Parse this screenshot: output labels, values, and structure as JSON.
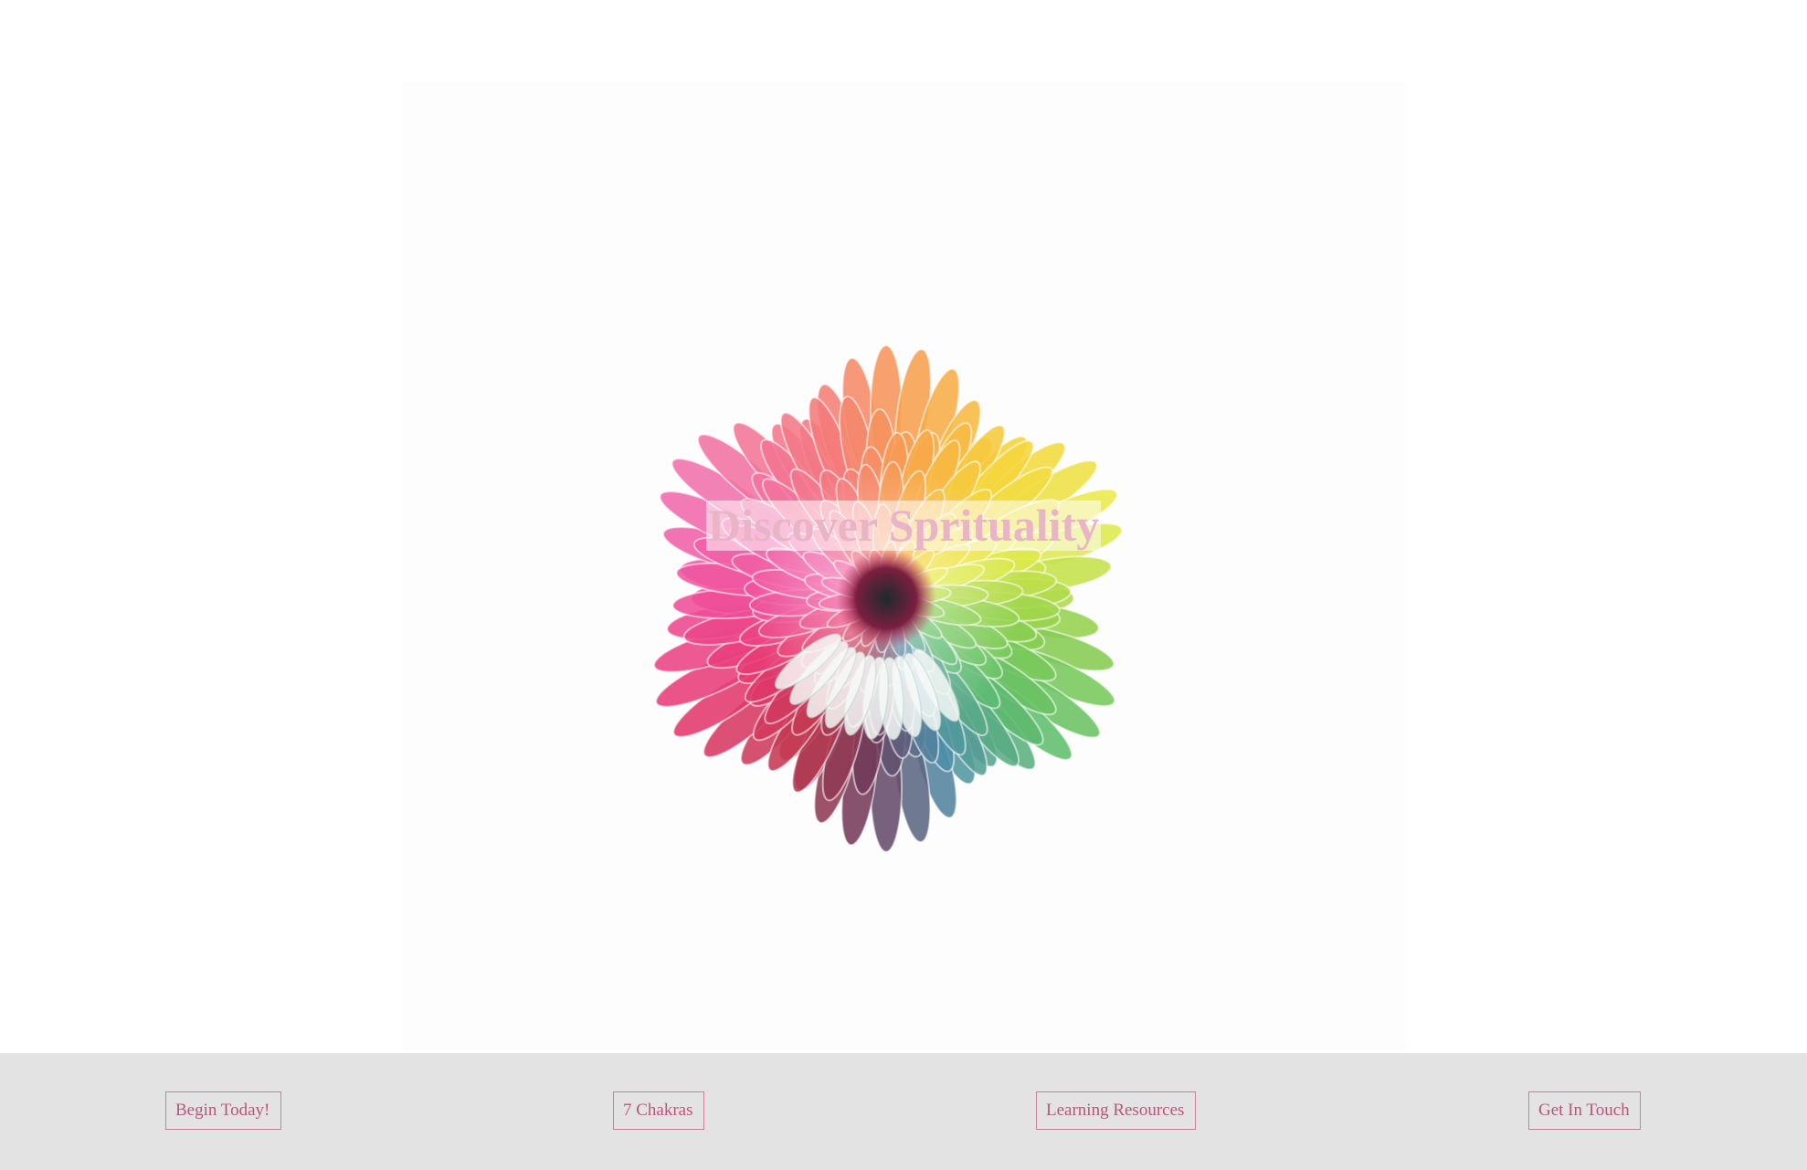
{
  "hero": {
    "title": "Discover Sprituality",
    "image": "rainbow-chrysanthemum-flower",
    "title_color": "#e8b4c6"
  },
  "nav": {
    "background": "#e3e3e3",
    "accent": "#b3587c",
    "items": [
      {
        "label": "Begin Today!"
      },
      {
        "label": "7 Chakras"
      },
      {
        "label": "Learning Resources"
      },
      {
        "label": "Get In Touch"
      }
    ]
  }
}
